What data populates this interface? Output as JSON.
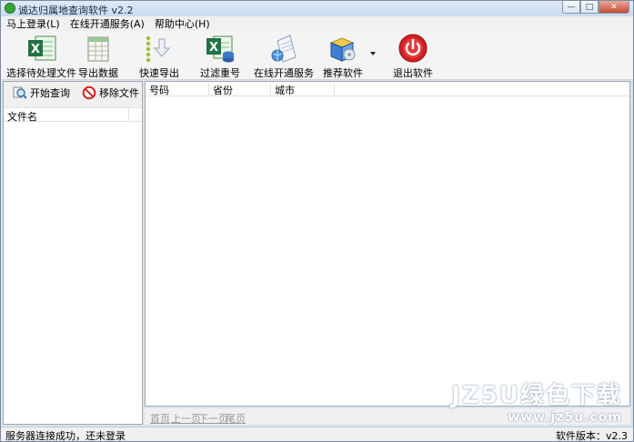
{
  "window": {
    "title": "诚达归属地查询软件 v2.2",
    "minimize": "—",
    "maximize": "□",
    "close": "✕"
  },
  "menu": [
    "马上登录(L)",
    "在线开通服务(A)",
    "帮助中心(H)"
  ],
  "toolbar": [
    {
      "label": "选择待处理文件",
      "icon": "excel-icon"
    },
    {
      "label": "导出数据",
      "icon": "spreadsheet-icon"
    },
    {
      "label": "快速导出",
      "icon": "download-arrow-icon"
    },
    {
      "label": "过滤重号",
      "icon": "excel-filter-icon"
    },
    {
      "label": "在线开通服务",
      "icon": "globe-document-icon"
    },
    {
      "label": "推荐软件",
      "icon": "software-box-icon"
    },
    {
      "label": "退出软件",
      "icon": "power-icon"
    }
  ],
  "left_panel": {
    "start_query": "开始查询",
    "remove_file": "移除文件",
    "column": "文件名"
  },
  "table": {
    "columns": [
      "号码",
      "省份",
      "城市"
    ],
    "rows": []
  },
  "pager": [
    "首页",
    "上一页",
    "下一页",
    "尾页"
  ],
  "status": {
    "left": "服务器连接成功，还未登录",
    "right": "软件版本：v2.3"
  },
  "watermark": {
    "line1": "JZ5U绿色下载",
    "line2": "www.jz5u.com"
  },
  "colors": {
    "accent": "#3aa335",
    "exit": "#d32020",
    "excel": "#217346"
  }
}
